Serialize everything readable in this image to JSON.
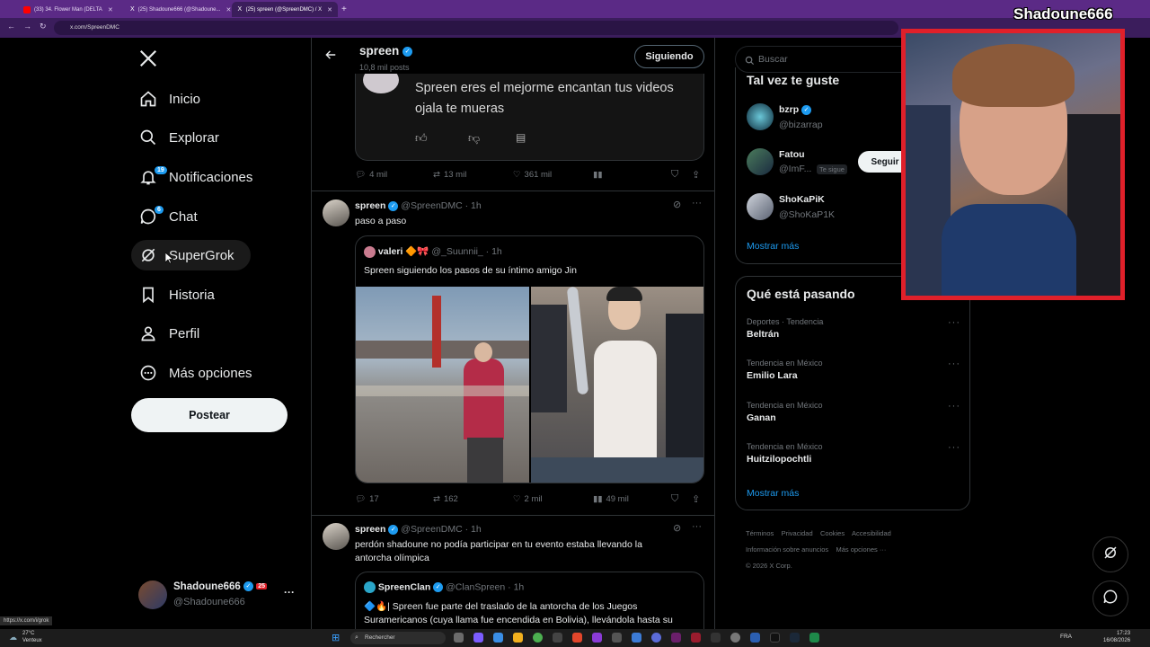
{
  "browser": {
    "tabs": [
      {
        "label": "(33) 34. Flower Man (DELTA",
        "icon_color": "#ff0000"
      },
      {
        "label": "(25) Shadoune666 (@Shadoune...",
        "icon_glyph": "X"
      },
      {
        "label": "(25) spreen (@SpreenDMC) / X",
        "icon_glyph": "X"
      }
    ],
    "url": "x.com/SpreenDMC",
    "status_url": "https://x.com/i/grok",
    "new_tab": "+"
  },
  "overlay": {
    "streamer_name": "Shadoune666"
  },
  "sidebar": {
    "items": [
      {
        "label": "Inicio",
        "icon": "home-icon"
      },
      {
        "label": "Explorar",
        "icon": "search-icon"
      },
      {
        "label": "Notificaciones",
        "icon": "bell-icon",
        "badge": "19"
      },
      {
        "label": "Chat",
        "icon": "chat-icon",
        "badge": "6"
      },
      {
        "label": "SuperGrok",
        "icon": "grok-icon"
      },
      {
        "label": "Historia",
        "icon": "bookmark-icon"
      },
      {
        "label": "Perfil",
        "icon": "person-icon"
      },
      {
        "label": "Más opciones",
        "icon": "more-circle-icon"
      }
    ],
    "post_button": "Postear",
    "account": {
      "name": "Shadoune666",
      "handle": "@Shadoune666",
      "extra_badge": "25"
    }
  },
  "header": {
    "name": "spreen",
    "posts_count": "10,8 mil posts",
    "follow_label": "Siguiendo"
  },
  "feed": {
    "tweet0": {
      "quoted_text_line1": "Spreen eres el mejorme encantan tus videos",
      "quoted_text_line2": "ojala te mueras",
      "replies": "4 mil",
      "retweets": "13 mil",
      "likes": "361 mil"
    },
    "tweet1": {
      "name": "spreen",
      "handle": "@SpreenDMC",
      "time": "· 1h",
      "text": "paso a paso",
      "quote": {
        "name": "valeri",
        "emoji": "🔶🎀",
        "handle": "@_Suunnii_",
        "time": "· 1h",
        "text": "Spreen siguiendo los pasos de su íntimo amigo Jin"
      },
      "replies": "17",
      "retweets": "162",
      "likes": "2 mil",
      "views": "49 mil"
    },
    "tweet2": {
      "name": "spreen",
      "handle": "@SpreenDMC",
      "time": "· 1h",
      "text_line1": "perdón shadoune no podía participar en tu evento estaba llevando la",
      "text_line2": "antorcha olímpica",
      "quote": {
        "name": "SpreenClan",
        "handle": "@ClanSpreen",
        "time": "· 1h",
        "text_line1": "🔷🔥| Spreen fue parte del traslado de la antorcha de los Juegos",
        "text_line2": "Suramericanos (cuya llama fue encendida en Bolivia), llevándola hasta su"
      }
    }
  },
  "right": {
    "search_placeholder": "Buscar",
    "suggest_title": "Tal vez te guste",
    "suggestions": [
      {
        "name": "bzrp",
        "handle": "@bizarrap",
        "verified": true
      },
      {
        "name": "Fatou",
        "handle": "@ImF...",
        "tag": "Te sigue",
        "follow": "Seguir"
      },
      {
        "name": "ShoKaPiK",
        "handle": "@ShoKaP1K"
      }
    ],
    "show_more": "Mostrar más",
    "trends_title": "Qué está pasando",
    "trends": [
      {
        "category": "Deportes · Tendencia",
        "name": "Beltrán"
      },
      {
        "category": "Tendencia en México",
        "name": "Emilio Lara"
      },
      {
        "category": "Tendencia en México",
        "name": "Ganan"
      },
      {
        "category": "Tendencia en México",
        "name": "Huitzilopochtli"
      }
    ],
    "trends_more": "Mostrar más",
    "footer": {
      "l1a": "Términos",
      "l1b": "Privacidad",
      "l1c": "Cookies",
      "l1d": "Accesibilidad",
      "l2a": "Información sobre anuncios",
      "l2b": "Más opciones ···",
      "copyright": "© 2026 X Corp."
    }
  },
  "taskbar": {
    "weather_temp": "27°C",
    "weather_desc": "Venteux",
    "search_placeholder": "Rechercher",
    "lang": "FRA",
    "time": "17:23",
    "date": "16/08/2026"
  },
  "colors": {
    "accent": "#1d9bf0",
    "chrome": "#5b2a86",
    "overlay_frame": "#e0202a"
  }
}
